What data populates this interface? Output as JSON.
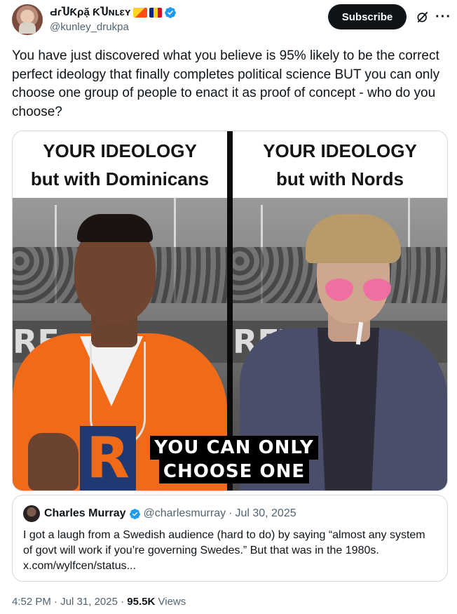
{
  "author": {
    "display_name": "ԀɾႮƘρặ ƘႮɴʟɛʏ",
    "handle": "@kunley_drukpa",
    "verified_color": "#1d9bf0"
  },
  "actions": {
    "subscribe_label": "Subscribe",
    "grok_icon": "grok-icon",
    "more_label": "···"
  },
  "tweet": {
    "text": "You have just discovered what you believe is 95% likely to be the correct perfect ideology that finally completes political science BUT you can only choose one group of people to enact it as proof of concept - who do you choose?"
  },
  "media": {
    "left_caption_line1": "YOUR IDEOLOGY",
    "left_caption_line2": "but with Dominicans",
    "right_caption_line1": "YOUR IDEOLOGY",
    "right_caption_line2": "but with Nords",
    "left_banner": "RE",
    "right_banner": "REV      NAR",
    "jersey_letter": "R",
    "overlay_line1": "YOU CAN ONLY",
    "overlay_line2": "CHOOSE ONE"
  },
  "quote": {
    "name": "Charles Murray",
    "handle": "@charlesmurray",
    "separator": "·",
    "date": "Jul 30, 2025",
    "text": "I got a laugh from a Swedish audience (hard to do) by saying “almost any system of govt will work if you’re governing Swedes.” But that was in the 1980s. x.com/wylfcen/status..."
  },
  "footer": {
    "time": "4:52 PM",
    "sep1": "·",
    "date": "Jul 31, 2025",
    "sep2": "·",
    "views_count": "95.5K",
    "views_label": "Views"
  }
}
